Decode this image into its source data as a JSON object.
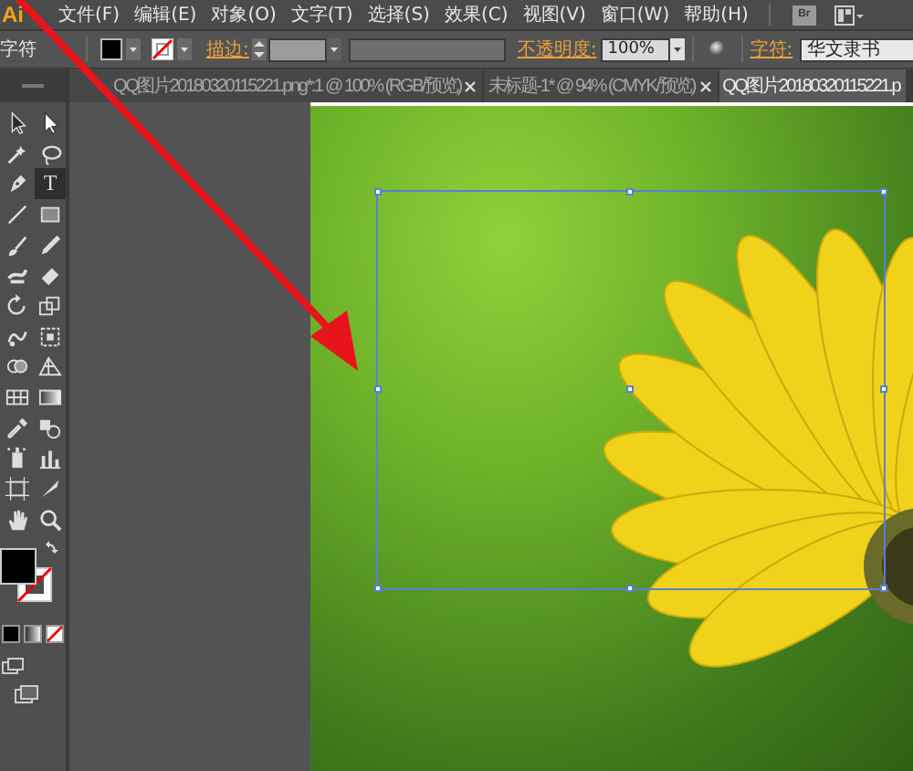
{
  "menubar": {
    "logo": "Ai",
    "items": [
      "文件(F)",
      "编辑(E)",
      "对象(O)",
      "文字(T)",
      "选择(S)",
      "效果(C)",
      "视图(V)",
      "窗口(W)",
      "帮助(H)"
    ],
    "bridge_button": "Br"
  },
  "control_bar": {
    "panel_label": "字符",
    "stroke_label": "描边:",
    "opacity_label": "不透明度:",
    "opacity_value": "100%",
    "character_label": "字符:",
    "font_value": "华文隶书"
  },
  "tabs": [
    {
      "label": "QQ图片20180320115221.png*:1 @ 100% (RGB/预览)",
      "selected": false,
      "closable": true
    },
    {
      "label": "未标题-1* @ 94% (CMYK/预览)",
      "selected": false,
      "closable": true
    },
    {
      "label": "QQ图片20180320115221.p",
      "selected": true,
      "closable": false
    }
  ],
  "toolbox": {
    "type_label": "T",
    "tools": [
      {
        "kind": "selection",
        "selected": false
      },
      {
        "kind": "direct",
        "selected": false
      },
      {
        "kind": "wand",
        "selected": false
      },
      {
        "kind": "lasso",
        "selected": false
      },
      {
        "kind": "pen",
        "selected": false
      },
      {
        "kind": "type",
        "selected": true
      },
      {
        "kind": "line",
        "selected": false
      },
      {
        "kind": "rect",
        "selected": false
      },
      {
        "kind": "brush",
        "selected": false
      },
      {
        "kind": "pencil",
        "selected": false
      },
      {
        "kind": "blob",
        "selected": false
      },
      {
        "kind": "eraser",
        "selected": false
      },
      {
        "kind": "rotate",
        "selected": false
      },
      {
        "kind": "scale",
        "selected": false
      },
      {
        "kind": "warp",
        "selected": false
      },
      {
        "kind": "transform",
        "selected": false
      },
      {
        "kind": "builder",
        "selected": false
      },
      {
        "kind": "perspective",
        "selected": false
      },
      {
        "kind": "mesh",
        "selected": false
      },
      {
        "kind": "gradient",
        "selected": false
      },
      {
        "kind": "eyedropper",
        "selected": false
      },
      {
        "kind": "blend",
        "selected": false
      },
      {
        "kind": "sprayer",
        "selected": false
      },
      {
        "kind": "graph",
        "selected": false
      },
      {
        "kind": "artboard",
        "selected": false
      },
      {
        "kind": "slice",
        "selected": false
      },
      {
        "kind": "hand",
        "selected": false
      },
      {
        "kind": "zoom",
        "selected": false
      }
    ]
  }
}
